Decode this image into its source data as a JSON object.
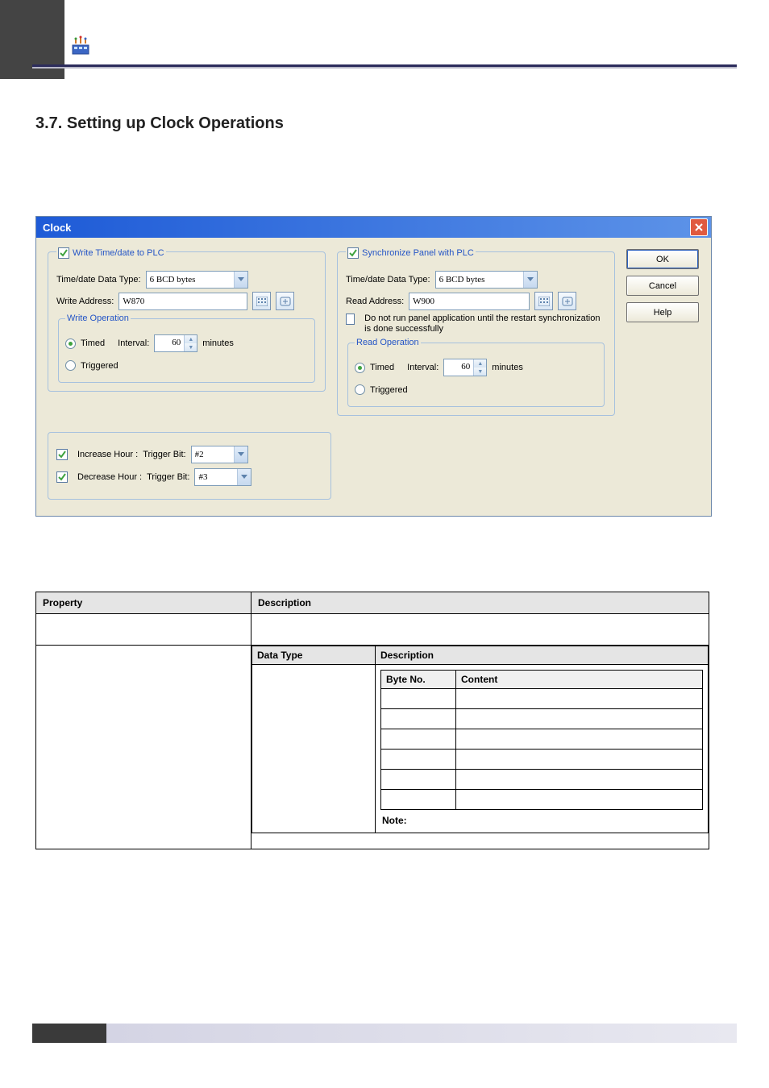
{
  "section_title": "3.7. Setting up Clock Operations",
  "dialog": {
    "title": "Clock",
    "buttons": {
      "ok": "OK",
      "cancel": "Cancel",
      "help": "Help"
    },
    "write": {
      "legend": "Write Time/date to PLC",
      "checked": true,
      "dtype_label": "Time/date Data Type:",
      "dtype_value": "6 BCD bytes",
      "addr_label": "Write Address:",
      "addr_value": "W870",
      "op_legend": "Write Operation",
      "timed_label": "Timed",
      "timed_sel": true,
      "interval_label": "Interval:",
      "interval_value": "60",
      "minutes_label": "minutes",
      "trig_label": "Triggered",
      "trig_sel": false
    },
    "sync": {
      "legend": "Synchronize Panel with PLC",
      "checked": true,
      "dtype_label": "Time/date Data Type:",
      "dtype_value": "6 BCD bytes",
      "addr_label": "Read Address:",
      "addr_value": "W900",
      "wait_checked": false,
      "wait_label": "Do not run panel application until the restart synchronization is done successfully",
      "op_legend": "Read Operation",
      "timed_label": "Timed",
      "timed_sel": true,
      "interval_label": "Interval:",
      "interval_value": "60",
      "minutes_label": "minutes",
      "trig_label": "Triggered",
      "trig_sel": false
    },
    "inc": {
      "checked": true,
      "label": "Increase Hour :",
      "trigger_label": "Trigger Bit:",
      "value": "#2"
    },
    "dec": {
      "checked": true,
      "label": "Decrease Hour :",
      "trigger_label": "Trigger Bit:",
      "value": "#3"
    }
  },
  "table": {
    "hdr_prop": "Property",
    "hdr_desc": "Description",
    "inner_hdr_dtype": "Data Type",
    "inner_hdr_desc": "Description",
    "byte_hdr_no": "Byte No.",
    "byte_hdr_content": "Content",
    "note_label": "Note:"
  }
}
